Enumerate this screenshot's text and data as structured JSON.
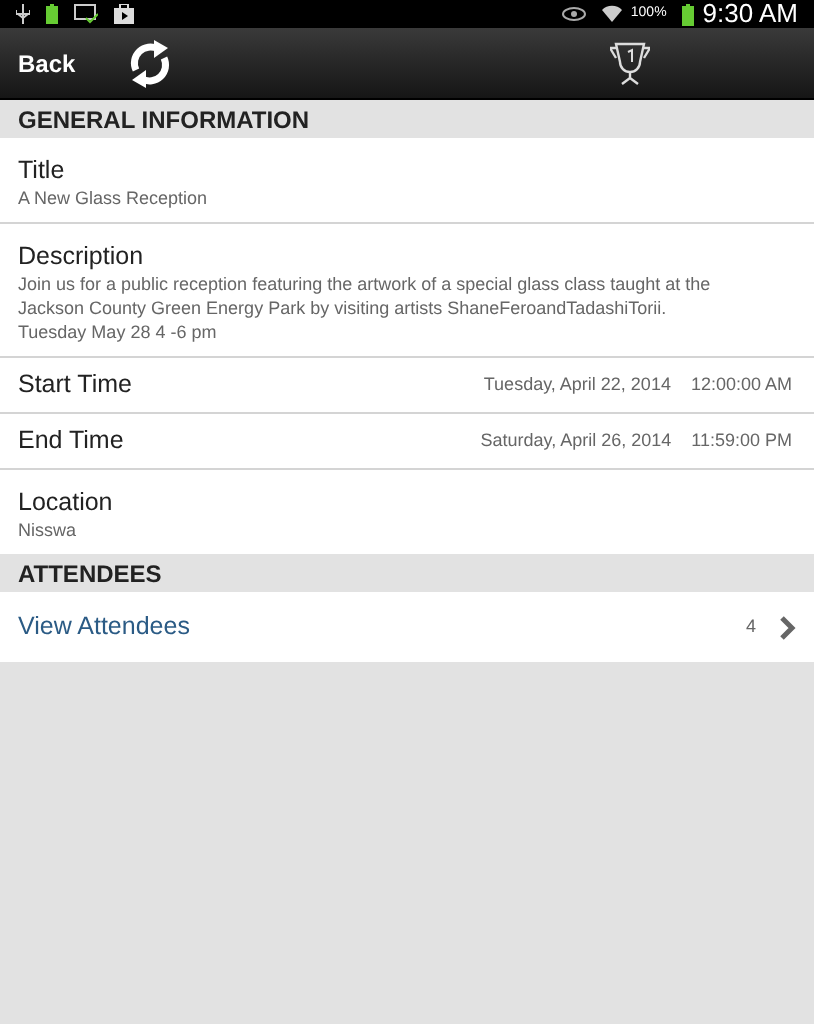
{
  "status_bar": {
    "battery_percent": "100%",
    "time": "9:30 AM"
  },
  "toolbar": {
    "back": "Back"
  },
  "sections": [
    {
      "header": "GENERAL INFORMATION",
      "rows": [
        {
          "kind": "stacked",
          "label": "Title",
          "value": "A New Glass Reception"
        },
        {
          "kind": "stacked",
          "label": "Description",
          "value": "Join us for a public reception featuring the artwork of a special glass class taught at the Jackson County Green Energy Park by visiting artists ShaneFeroandTadashiTorii. Tuesday May 28 4 -6 pm"
        },
        {
          "kind": "inline",
          "label": "Start Time",
          "date": "Tuesday, April 22, 2014",
          "time": "12:00:00 AM"
        },
        {
          "kind": "inline",
          "label": "End Time",
          "date": "Saturday, April 26, 2014",
          "time": "11:59:00 PM"
        },
        {
          "kind": "stacked",
          "label": "Location",
          "value": "Nisswa"
        }
      ]
    },
    {
      "header": "ATTENDEES",
      "rows": [
        {
          "kind": "link",
          "label": "View Attendees",
          "count": "4"
        }
      ]
    }
  ]
}
